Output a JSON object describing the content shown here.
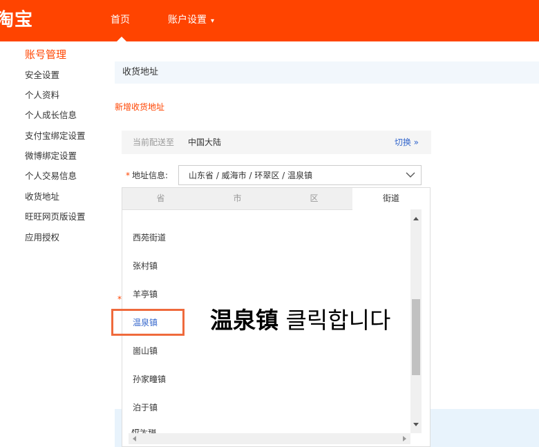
{
  "brand": {
    "logo_text": "淘宝"
  },
  "nav": {
    "home": "首页",
    "account_settings": "账户设置",
    "caret": "⌄"
  },
  "sidebar": {
    "title": "账号管理",
    "items": [
      {
        "label": "安全设置"
      },
      {
        "label": "个人资料"
      },
      {
        "label": "个人成长信息"
      },
      {
        "label": "支付宝绑定设置"
      },
      {
        "label": "微博绑定设置"
      },
      {
        "label": "个人交易信息"
      },
      {
        "label": "收货地址"
      },
      {
        "label": "旺旺网页版设置"
      },
      {
        "label": "应用授权"
      }
    ]
  },
  "main": {
    "section_title": "收货地址",
    "add_address": "新增收货地址",
    "delivery": {
      "label": "当前配送至",
      "value": "中国大陆",
      "switch": "切换 »"
    },
    "address_field": {
      "required_mark": "*",
      "label": "地址信息:",
      "value": "山东省 / 威海市 / 环翠区 / 温泉镇"
    }
  },
  "dropdown": {
    "tabs": [
      "省",
      "市",
      "区",
      "街道"
    ],
    "active_tab": "街道",
    "options": [
      "西苑街道",
      "张村镇",
      "羊亭镇",
      "温泉镇",
      "崮山镇",
      "孙家疃镇",
      "泊于镇"
    ],
    "selected_option": "温泉镇",
    "partial_option": "桥头镇"
  },
  "annotation": {
    "target": "温泉镇",
    "instruction": "클릭합니다",
    "color": "#ef6a3c"
  },
  "colors": {
    "brand": "#ff4400",
    "link": "#3366cc"
  }
}
